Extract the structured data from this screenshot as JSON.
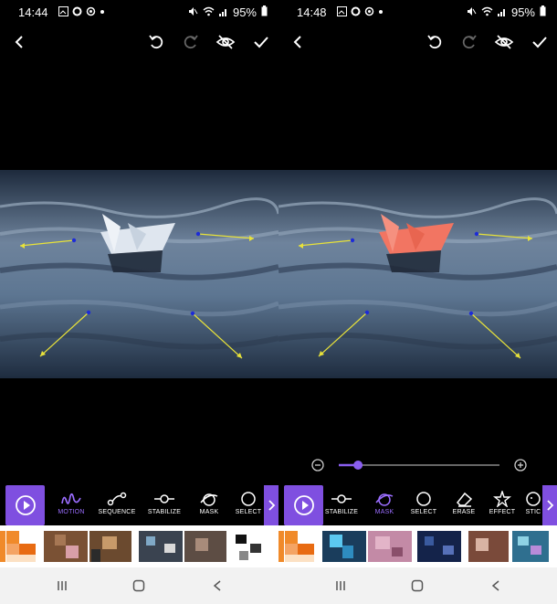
{
  "screens": [
    {
      "status": {
        "time": "14:44",
        "battery": "95%"
      },
      "tools": [
        {
          "label": "MOTION",
          "icon": "motion-icon",
          "active": true
        },
        {
          "label": "SEQUENCE",
          "icon": "sequence-icon",
          "active": false
        },
        {
          "label": "STABILIZE",
          "icon": "stabilize-icon",
          "active": false
        },
        {
          "label": "MASK",
          "icon": "mask-icon",
          "active": false
        },
        {
          "label": "SELECT",
          "icon": "select-icon",
          "active": false
        }
      ],
      "slider_visible": false
    },
    {
      "status": {
        "time": "14:48",
        "battery": "95%"
      },
      "tools": [
        {
          "label": "STABILIZE",
          "icon": "stabilize-icon",
          "active": false
        },
        {
          "label": "MASK",
          "icon": "mask-icon",
          "active": true
        },
        {
          "label": "SELECT",
          "icon": "select-icon",
          "active": false
        },
        {
          "label": "ERASE",
          "icon": "erase-icon",
          "active": false
        },
        {
          "label": "EFFECT",
          "icon": "effect-icon",
          "active": false
        },
        {
          "label": "STIC",
          "icon": "sticker-icon",
          "active": false
        }
      ],
      "slider_visible": true,
      "slider_value": 0.12
    }
  ],
  "colors": {
    "accent": "#7f4fe0",
    "mask_highlight": "#f27562",
    "motion_arrow": "#e8e23a",
    "anchor_dot": "#1d2bd8"
  }
}
